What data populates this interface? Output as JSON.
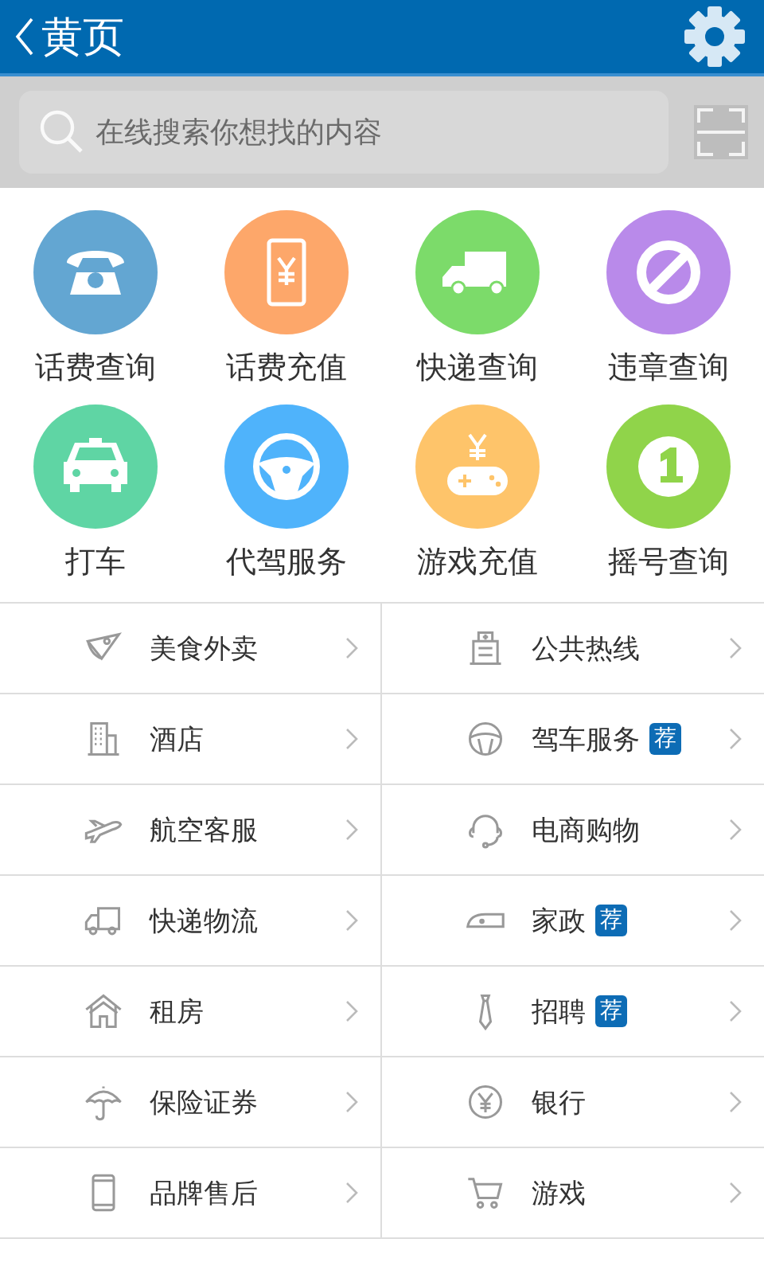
{
  "header": {
    "title": "黄页"
  },
  "search": {
    "placeholder": "在线搜索你想找的内容"
  },
  "services": [
    {
      "label": "话费查询",
      "color": "#63a6d2"
    },
    {
      "label": "话费充值",
      "color": "#fda76a"
    },
    {
      "label": "快递查询",
      "color": "#7cdb6a"
    },
    {
      "label": "违章查询",
      "color": "#b98aea"
    },
    {
      "label": "打车",
      "color": "#5fd5a4"
    },
    {
      "label": "代驾服务",
      "color": "#4fb3fb"
    },
    {
      "label": "游戏充值",
      "color": "#fec46a"
    },
    {
      "label": "摇号查询",
      "color": "#90d44a"
    }
  ],
  "categories": [
    {
      "label": "美食外卖"
    },
    {
      "label": "公共热线"
    },
    {
      "label": "酒店"
    },
    {
      "label": "驾车服务",
      "badge": "荐"
    },
    {
      "label": "航空客服"
    },
    {
      "label": "电商购物"
    },
    {
      "label": "快递物流"
    },
    {
      "label": "家政",
      "badge": "荐"
    },
    {
      "label": "租房"
    },
    {
      "label": "招聘",
      "badge": "荐"
    },
    {
      "label": "保险证券"
    },
    {
      "label": "银行"
    },
    {
      "label": "品牌售后"
    },
    {
      "label": "游戏"
    }
  ]
}
